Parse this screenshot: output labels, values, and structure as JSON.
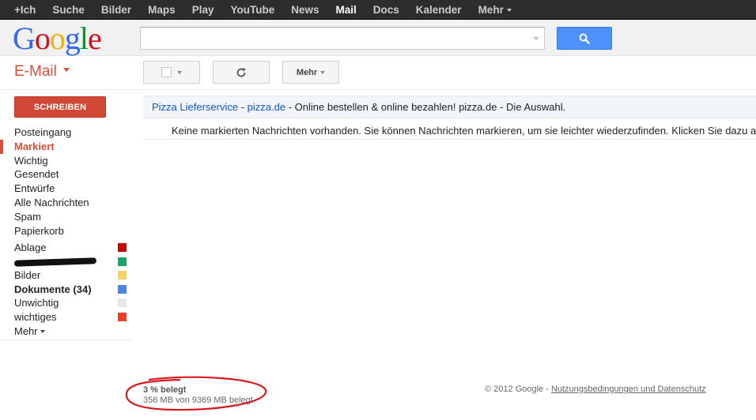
{
  "topbar": {
    "items": [
      {
        "label": "+Ich"
      },
      {
        "label": "Suche"
      },
      {
        "label": "Bilder"
      },
      {
        "label": "Maps"
      },
      {
        "label": "Play"
      },
      {
        "label": "YouTube"
      },
      {
        "label": "News"
      },
      {
        "label": "Mail",
        "active": true
      },
      {
        "label": "Docs"
      },
      {
        "label": "Kalender"
      },
      {
        "label": "Mehr"
      }
    ]
  },
  "search": {
    "value": "",
    "placeholder": ""
  },
  "mail_title": "E-Mail",
  "toolbar": {
    "more_label": "Mehr"
  },
  "compose_label": "SCHREIBEN",
  "nav": {
    "items": [
      {
        "label": "Posteingang"
      },
      {
        "label": "Markiert",
        "active": true
      },
      {
        "label": "Wichtig"
      },
      {
        "label": "Gesendet"
      },
      {
        "label": "Entwürfe"
      },
      {
        "label": "Alle Nachrichten"
      },
      {
        "label": "Spam"
      },
      {
        "label": "Papierkorb"
      }
    ]
  },
  "labels": {
    "items": [
      {
        "label": "Ablage",
        "color": "#cc0000"
      },
      {
        "label": "",
        "color": "#16a765",
        "redacted": true
      },
      {
        "label": "Bilder",
        "color": "#fad165"
      },
      {
        "label": "Dokumente (34)",
        "color": "#4986e7",
        "bold": true
      },
      {
        "label": "Unwichtig",
        "color": "#e7e7e7"
      },
      {
        "label": "wichtiges",
        "color": "#f83a22"
      }
    ],
    "more_label": "Mehr"
  },
  "ad": {
    "title": "Pizza Lieferservice",
    "sep1": " - ",
    "domain": "pizza.de",
    "text": " - Online bestellen & online bezahlen! pizza.de - Die Auswahl."
  },
  "empty_message": "Keine markierten Nachrichten vorhanden. Sie können Nachrichten markieren, um sie leichter wiederzufinden. Klicken Sie dazu auf",
  "storage": {
    "percent_text": "3 % belegt",
    "detail_text": "356 MB von 9369 MB belegt",
    "used_fraction": 0.03
  },
  "footer": {
    "copyright": "© 2012 Google - ",
    "terms_link": "Nutzungsbedingungen und Datenschutz"
  },
  "colors": {
    "topbar": "#2d2d2d",
    "accent_red": "#dd4b39",
    "compose_bg": "#d14836",
    "search_button": "#4d90fe",
    "link_blue": "#1155cc",
    "annotation_circle": "#d71920"
  }
}
